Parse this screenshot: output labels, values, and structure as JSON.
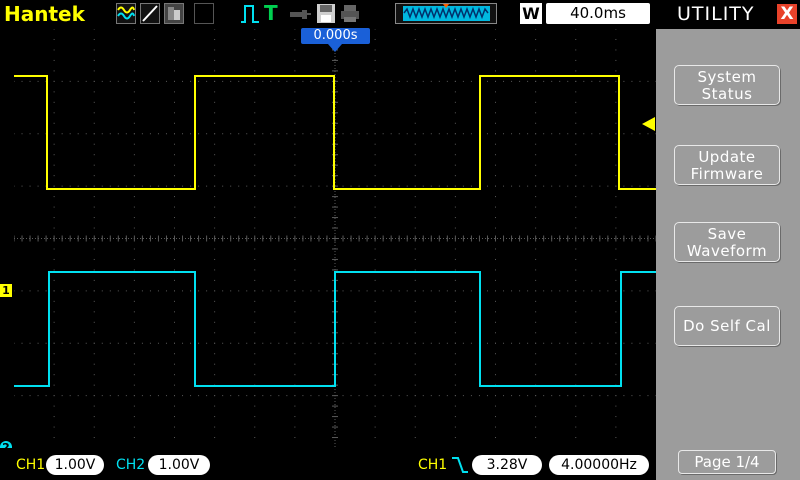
{
  "brand": "Hantek",
  "toolbar": {
    "icons": [
      "waveform-icon",
      "line-icon",
      "persist-icon",
      "pulse-icon",
      "trigger-t-icon",
      "probe-icon",
      "save-disk-icon",
      "print-icon"
    ]
  },
  "top": {
    "w_label": "W",
    "timebase": "40.0ms"
  },
  "screen": {
    "trigger_time": "0.000s"
  },
  "utility": {
    "title": "UTILITY",
    "close": "X",
    "buttons": [
      {
        "line1": "System",
        "line2": "Status"
      },
      {
        "line1": "Update",
        "line2": "Firmware"
      },
      {
        "line1": "Save",
        "line2": "Waveform"
      },
      {
        "line1": "Do Self Cal",
        "line2": ""
      }
    ],
    "page": "Page 1/4"
  },
  "bottom": {
    "ch1_label": "CH1",
    "ch1_scale": "1.00V",
    "ch2_label": "CH2",
    "ch2_scale": "1.00V",
    "trig_source": "CH1",
    "trig_level": "3.28V",
    "frequency": "4.00000Hz"
  },
  "markers": {
    "ch1": "1",
    "ch2": "2"
  },
  "colors": {
    "ch1": "#ffff00",
    "ch2": "#00e0f0",
    "grid": "#5a5a5a",
    "menu_bg": "#9c9c9c",
    "trigger_marker": "#ffff00"
  }
}
